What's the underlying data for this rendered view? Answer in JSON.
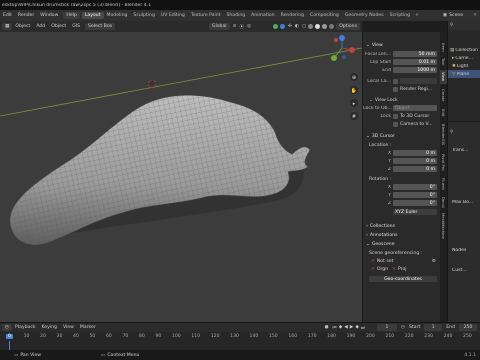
{
  "titlebar": {
    "path": "esktop\\WIP\\Chikun drumstick raw\\2spc 5 (3).blend] - Blender 4.1"
  },
  "menubar": {
    "items": [
      "Edit",
      "Render",
      "Window",
      "Help"
    ],
    "workspaces": [
      "Layout",
      "Modeling",
      "Sculpting",
      "UV Editing",
      "Texture Paint",
      "Shading",
      "Animation",
      "Rendering",
      "Compositing",
      "Geometry Nodes",
      "Scripting"
    ],
    "active_workspace": "Layout",
    "scene": "Scene"
  },
  "viewport_header": {
    "menus": [
      "Object",
      "Add",
      "Object",
      "GIS"
    ],
    "select": "Select Box",
    "global": "Global",
    "options": "Options"
  },
  "npanel": {
    "view_title": "View",
    "focal_length_label": "Focal Len...",
    "focal_length": "50 mm",
    "clip_start_label": "Clip Start",
    "clip_start": "0.01 m",
    "clip_end_label": "End",
    "clip_end": "1000 m",
    "local_camera_label": "Local Ca...",
    "render_region_label": "Render Regi...",
    "view_lock_title": "View Lock",
    "lock_to_object_label": "Lock to Ob...",
    "object_placeholder": "Object",
    "lock_label": "Lock",
    "to_3d_cursor": "To 3D Cursor",
    "camera_to_view": "Camera to V...",
    "cursor_title": "3D Cursor",
    "location_label": "Location :",
    "x_label": "X",
    "y_label": "Y",
    "z_label": "Z",
    "loc_x": "0 m",
    "loc_y": "0 m",
    "loc_z": "0 m",
    "rotation_label": "Rotation :",
    "rot_x": "0°",
    "rot_y": "0°",
    "rot_z": "0°",
    "rotation_mode": "XYZ Euler",
    "collections": "Collections",
    "annotations": "Annotations",
    "geoscene": "Geoscene",
    "georef_label": "Scene georeferencing :",
    "not_set": "Not set",
    "origin_label": "Orgn",
    "proj_label": "Proj",
    "geo_coords": "Geo-coordinates"
  },
  "tabs": [
    "Item",
    "Tool",
    "View",
    "Create",
    "Edit",
    "BlenderGIS",
    "Pivot Pro",
    "Fluent",
    "Decal",
    "MeshMachine"
  ],
  "active_tab": "View",
  "outliner": {
    "collection": "Collection",
    "items": [
      "Came...",
      "Light",
      "Plane"
    ]
  },
  "props": {
    "labels": [
      "Trans...",
      "Nodes",
      "Cust..."
    ],
    "misc": "Max Bo..."
  },
  "timeline": {
    "menus": [
      "Playback",
      "Keying",
      "View",
      "Marker"
    ],
    "current_frame": "1",
    "start_label": "Start",
    "start": "1",
    "end_label": "End",
    "end": "250",
    "ruler": [
      "0",
      "10",
      "20",
      "30",
      "40",
      "50",
      "60",
      "70",
      "80",
      "90",
      "100",
      "110",
      "120",
      "130",
      "140",
      "150",
      "160",
      "170",
      "180",
      "190",
      "200",
      "210",
      "220",
      "230",
      "240",
      "250"
    ]
  },
  "statusbar": {
    "hint1": "Pan View",
    "hint2": "Context Menu",
    "version": "4.1.1"
  },
  "colors": {
    "accent": "#4a86d8",
    "viewport": "#3c3c3c",
    "mesh": "#a9a9a9"
  }
}
